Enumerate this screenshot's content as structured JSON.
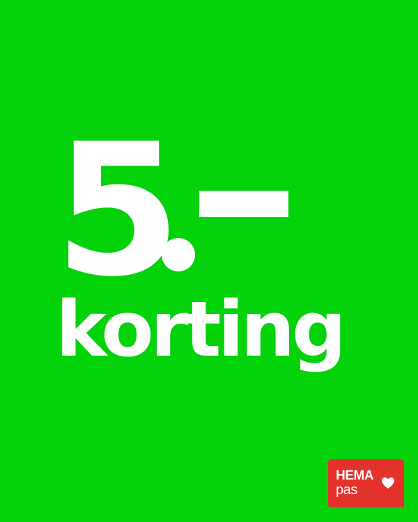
{
  "colors": {
    "background": "#04d20a",
    "foreground": "#ffffff",
    "badge": "#e3312c"
  },
  "promo": {
    "amount": "5",
    "label": "korting"
  },
  "badge": {
    "line1": "HEMA",
    "line2": "pas",
    "icon": "heart-icon"
  }
}
